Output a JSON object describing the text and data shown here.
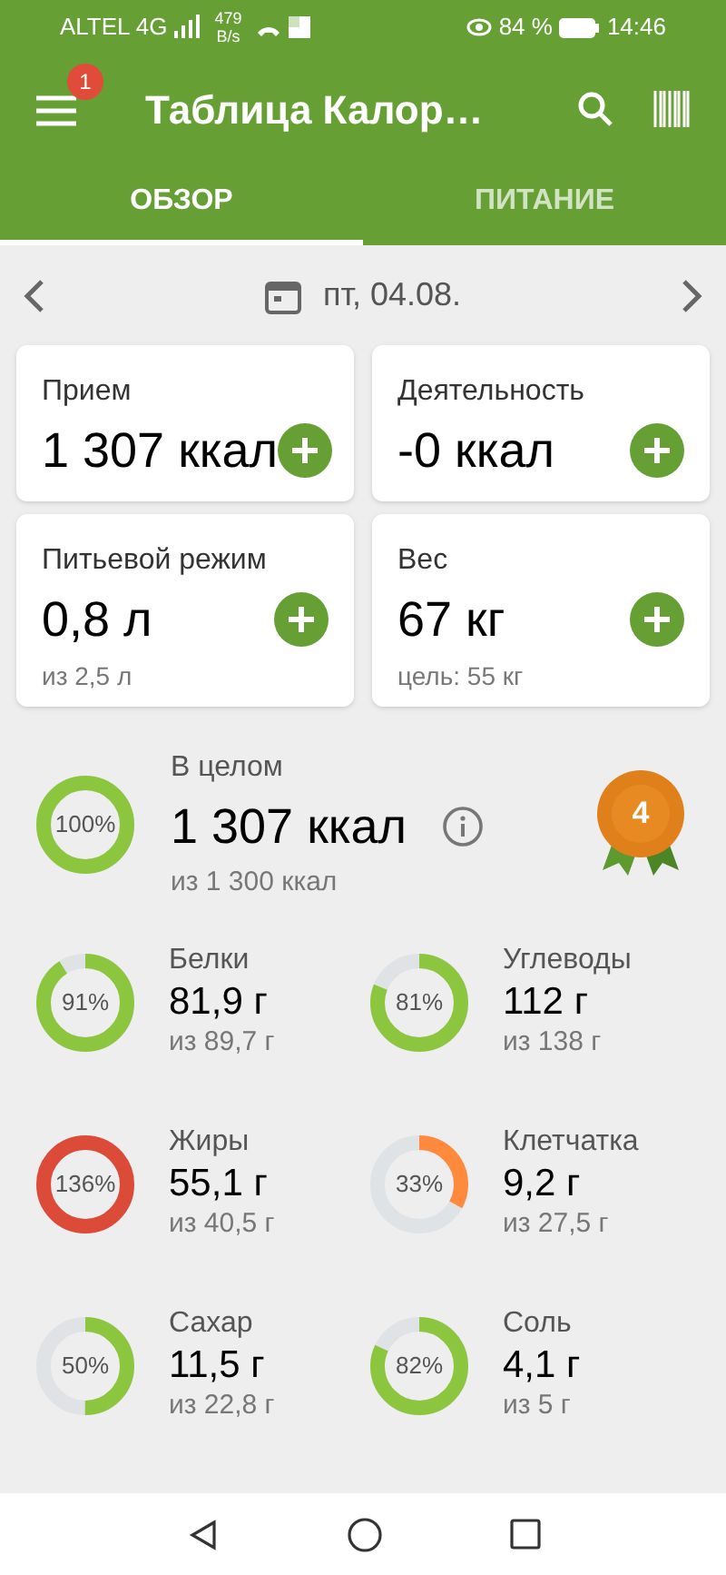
{
  "status_bar": {
    "carrier": "ALTEL 4G",
    "speed_value": "479",
    "speed_unit": "B/s",
    "battery": "84 %",
    "time": "14:46"
  },
  "app_bar": {
    "title": "Таблица Калор…",
    "notification_count": "1"
  },
  "tabs": [
    {
      "label": "ОБЗОР",
      "selected": true
    },
    {
      "label": "ПИТАНИЕ",
      "selected": false
    }
  ],
  "date": "пт, 04.08.",
  "cards": [
    {
      "label": "Прием",
      "value": "1 307 ккал"
    },
    {
      "label": "Деятельность",
      "value": "-0 ккал"
    },
    {
      "label": "Питьевой режим",
      "value": "0,8 л",
      "sub": "из 2,5 л"
    },
    {
      "label": "Вес",
      "value": "67 кг",
      "sub": "цель: 55 кг"
    }
  ],
  "overall": {
    "label": "В целом",
    "value": "1 307 ккал",
    "goal": "из 1 300 ккал",
    "percent": "100%",
    "level": 1,
    "color": "#8cc63f",
    "badge": "4"
  },
  "nutrients": [
    {
      "name": "Белки",
      "value": "81,9 г",
      "goal": "из 89,7 г",
      "percent": "91%",
      "level": 0.91,
      "color": "#8cc63f"
    },
    {
      "name": "Углеводы",
      "value": "112 г",
      "goal": "из 138 г",
      "percent": "81%",
      "level": 0.81,
      "color": "#8cc63f"
    },
    {
      "name": "Жиры",
      "value": "55,1 г",
      "goal": "из 40,5 г",
      "percent": "136%",
      "level": 1,
      "color": "#dc4b38"
    },
    {
      "name": "Клетчатка",
      "value": "9,2 г",
      "goal": "из 27,5 г",
      "percent": "33%",
      "level": 0.33,
      "color": "#ff8a3d"
    },
    {
      "name": "Сахар",
      "value": "11,5 г",
      "goal": "из 22,8 г",
      "percent": "50%",
      "level": 0.5,
      "color": "#8cc63f"
    },
    {
      "name": "Соль",
      "value": "4,1 г",
      "goal": "из 5 г",
      "percent": "82%",
      "level": 0.82,
      "color": "#8cc63f"
    }
  ]
}
